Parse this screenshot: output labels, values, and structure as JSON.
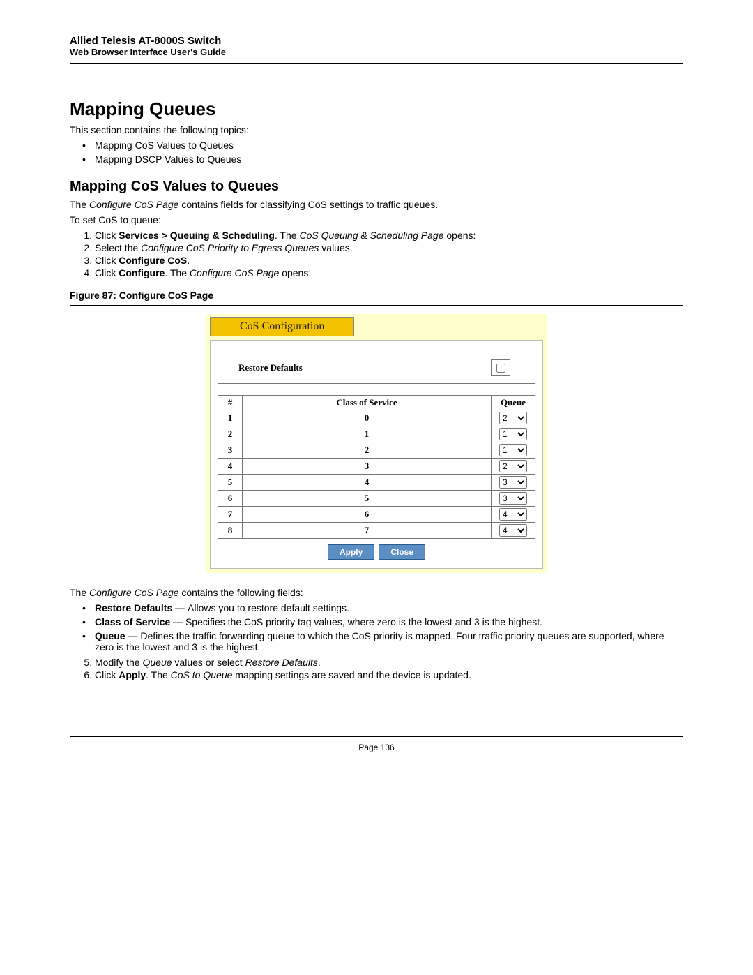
{
  "header": {
    "title": "Allied Telesis AT-8000S Switch",
    "subtitle": "Web Browser Interface User's Guide"
  },
  "h1": "Mapping Queues",
  "intro": "This section contains the following topics:",
  "topics": [
    "Mapping CoS Values to Queues",
    "Mapping DSCP Values to Queues"
  ],
  "h2": "Mapping CoS Values to Queues",
  "para1_pre": "The ",
  "para1_em": "Configure CoS Page",
  "para1_post": " contains fields for classifying CoS settings to traffic queues.",
  "para2": "To set CoS to queue:",
  "steps": {
    "s1_a": "Click ",
    "s1_b": "Services > Queuing & Scheduling",
    "s1_c": ". The ",
    "s1_d": "CoS Queuing & Scheduling Page",
    "s1_e": " opens:",
    "s2_a": "Select the ",
    "s2_b": "Configure CoS Priority to Egress Queues",
    "s2_c": " values.",
    "s3_a": "Click ",
    "s3_b": "Configure CoS",
    "s3_c": ".",
    "s4_a": "Click ",
    "s4_b": "Configure",
    "s4_c": ". The ",
    "s4_d": "Configure CoS Page",
    "s4_e": " opens:"
  },
  "figcap": "Figure 87:  Configure CoS Page",
  "figure": {
    "tab": "CoS Configuration",
    "restore_label": "Restore Defaults",
    "columns": {
      "num": "#",
      "cos": "Class of Service",
      "queue": "Queue"
    },
    "rows": [
      {
        "n": "1",
        "cos": "0",
        "q": "2"
      },
      {
        "n": "2",
        "cos": "1",
        "q": "1"
      },
      {
        "n": "3",
        "cos": "2",
        "q": "1"
      },
      {
        "n": "4",
        "cos": "3",
        "q": "2"
      },
      {
        "n": "5",
        "cos": "4",
        "q": "3"
      },
      {
        "n": "6",
        "cos": "5",
        "q": "3"
      },
      {
        "n": "7",
        "cos": "6",
        "q": "4"
      },
      {
        "n": "8",
        "cos": "7",
        "q": "4"
      }
    ],
    "apply": "Apply",
    "close": "Close"
  },
  "after_fig_pre": "The ",
  "after_fig_em": "Configure CoS Page",
  "after_fig_post": " contains the following fields:",
  "fields": {
    "f1_b": "Restore Defaults — ",
    "f1_t": "Allows you to restore default settings.",
    "f2_b": "Class of Service — ",
    "f2_t": "Specifies the CoS priority tag values, where zero is the lowest and 3 is the highest.",
    "f3_b": "Queue — ",
    "f3_t": "Defines the traffic forwarding queue to which the CoS priority is mapped. Four traffic priority queues are supported, where zero is the lowest and 3 is the highest."
  },
  "steps2": {
    "s5_a": "Modify the ",
    "s5_b": "Queue",
    "s5_c": " values or select ",
    "s5_d": "Restore Defaults",
    "s5_e": ".",
    "s6_a": "Click ",
    "s6_b": "Apply",
    "s6_c": ". The ",
    "s6_d": "CoS to Queue",
    "s6_e": " mapping settings are saved and the device is updated."
  },
  "page_num": "Page 136"
}
